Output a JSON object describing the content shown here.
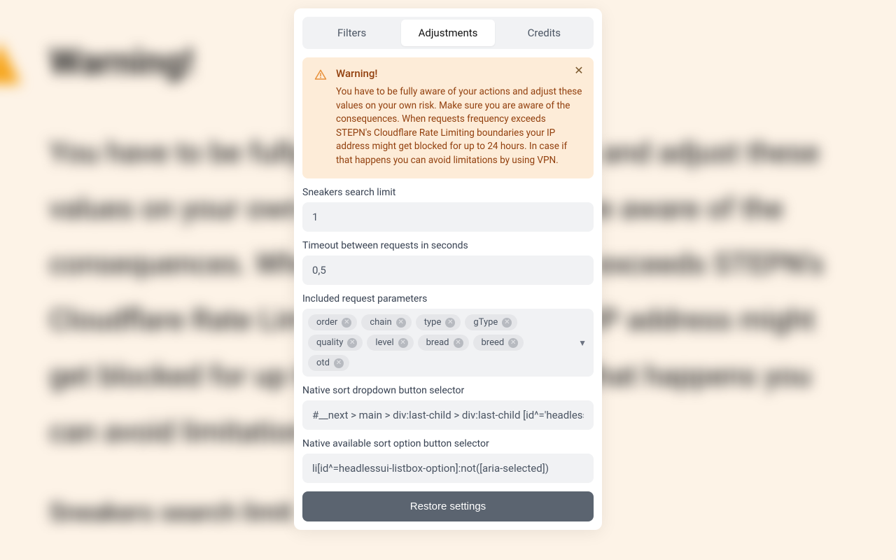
{
  "bg": {
    "title": "Warning!",
    "body": "You have to be fully aware of your actions and adjust these values on your own risk. Make sure you are aware of the consequences. When requests frequency exceeds STEPN's Cloudflare Rate Limiting boundaries your IP address might get blocked for up to 24 hours. In case if that happens you can avoid limitations by using VPN.",
    "label": "Sneakers search limit"
  },
  "tabs": {
    "filters": "Filters",
    "adjustments": "Adjustments",
    "credits": "Credits"
  },
  "alert": {
    "title": "Warning!",
    "body": "You have to be fully aware of your actions and adjust these values on your own risk. Make sure you are aware of the consequences. When requests frequency exceeds STEPN's Cloudflare Rate Limiting boundaries your IP address might get blocked for up to 24 hours. In case if that happens you can avoid limitations by using VPN."
  },
  "fields": {
    "searchLimit": {
      "label": "Sneakers search limit",
      "value": "1"
    },
    "timeout": {
      "label": "Timeout between requests in seconds",
      "value": "0,5"
    },
    "params": {
      "label": "Included request parameters"
    },
    "nativeSort": {
      "label": "Native sort dropdown button selector",
      "value": "#__next > main > div:last-child > div:last-child [id^='headlessui-listbox-button']"
    },
    "nativeOption": {
      "label": "Native available sort option button selector",
      "value": "li[id^=headlessui-listbox-option]:not([aria-selected])"
    }
  },
  "chips": [
    "order",
    "chain",
    "type",
    "gType",
    "quality",
    "level",
    "bread",
    "breed",
    "otd"
  ],
  "restore": "Restore settings"
}
